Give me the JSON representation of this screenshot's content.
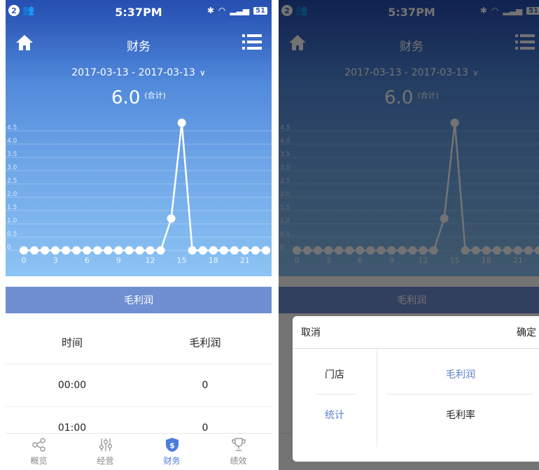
{
  "status": {
    "time": "5:37PM",
    "badge": "2",
    "battery": "51"
  },
  "header": {
    "title": "财务"
  },
  "date_range": {
    "text": "2017-03-13  -  2017-03-13",
    "chevron": "∨"
  },
  "total": {
    "value": "6.0",
    "suffix": "(合计)"
  },
  "chart_data": {
    "type": "line",
    "x": [
      0,
      1,
      2,
      3,
      4,
      5,
      6,
      7,
      8,
      9,
      10,
      11,
      12,
      13,
      14,
      15,
      16,
      17,
      18,
      19,
      20,
      21,
      22,
      23
    ],
    "values": [
      0,
      0,
      0,
      0,
      0,
      0,
      0,
      0,
      0,
      0,
      0,
      0,
      0,
      0,
      1.2,
      4.8,
      0,
      0,
      0,
      0,
      0,
      0,
      0,
      0
    ],
    "xticks": [
      "0",
      "3",
      "6",
      "9",
      "12",
      "15",
      "18",
      "21"
    ],
    "yticks": [
      "0",
      "0.5",
      "1.0",
      "1.5",
      "2.0",
      "2.5",
      "3.0",
      "3.5",
      "4.0",
      "4.5"
    ],
    "ylim": [
      0,
      5
    ],
    "grid": true
  },
  "section": {
    "label": "毛利润"
  },
  "table": {
    "columns": [
      "时间",
      "毛利润"
    ],
    "rows": [
      [
        "00:00",
        "0"
      ],
      [
        "01:00",
        "0"
      ]
    ]
  },
  "tabs": [
    {
      "label": "概览",
      "icon": "share-icon"
    },
    {
      "label": "经营",
      "icon": "sliders-icon"
    },
    {
      "label": "财务",
      "icon": "dollar-shield-icon"
    },
    {
      "label": "绩效",
      "icon": "trophy-icon"
    }
  ],
  "picker": {
    "cancel": "取消",
    "confirm": "确定",
    "left_options": [
      "门店",
      "统计"
    ],
    "right_options": [
      "毛利润",
      "毛利率"
    ]
  },
  "colors": {
    "accent": "#4a7be0",
    "section": "#6f8fd2",
    "picker_selected": "#5a7fd0"
  }
}
